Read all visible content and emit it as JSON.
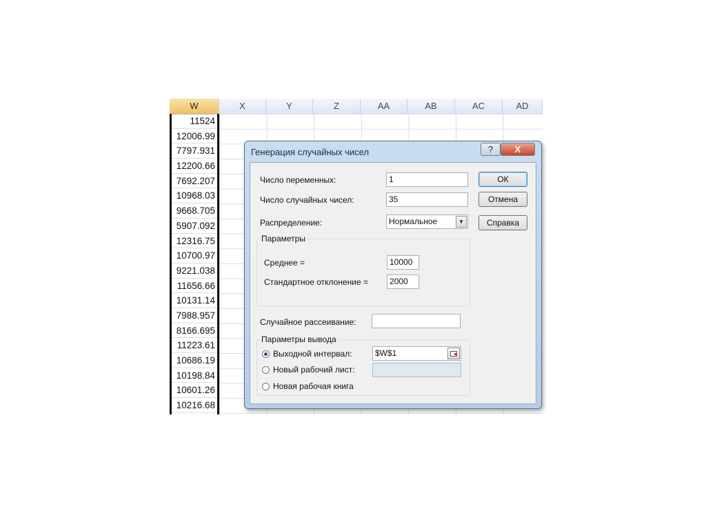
{
  "sheet": {
    "columns": [
      "W",
      "X",
      "Y",
      "Z",
      "AA",
      "AB",
      "AC",
      "AD"
    ],
    "w_values": [
      "11524",
      "12006.99",
      "7797.931",
      "12200.66",
      "7692.207",
      "10968.03",
      "9668.705",
      "5907.092",
      "12316.75",
      "10700.97",
      "9221.038",
      "11656.66",
      "10131.14",
      "7988.957",
      "8166.695",
      "11223.61",
      "10686.19",
      "10198.84",
      "10601.26",
      "10216.68"
    ]
  },
  "dialog": {
    "title": "Генерация случайных чисел",
    "help_label": "?",
    "close_label": "X",
    "num_vars_label": "Число переменных:",
    "num_vars_value": "1",
    "num_random_label": "Число случайных чисел:",
    "num_random_value": "35",
    "distribution_label": "Распределение:",
    "distribution_value": "Нормальное",
    "ok_label": "ОК",
    "cancel_label": "Отмена",
    "help_button_label": "Справка",
    "params_group_title": "Параметры",
    "mean_label": "Среднее =",
    "mean_value": "10000",
    "stddev_label": "Стандартное отклонение =",
    "stddev_value": "2000",
    "random_seed_label": "Случайное рассеивание:",
    "random_seed_value": "",
    "output_group_title": "Параметры вывода",
    "output_range_label": "Выходной интервал:",
    "output_range_value": "$W$1",
    "new_sheet_label": "Новый рабочий лист:",
    "new_sheet_value": "",
    "new_book_label": "Новая рабочая книга"
  },
  "colors": {
    "active_header": "#f1c15f",
    "close_button": "#c9442c"
  }
}
